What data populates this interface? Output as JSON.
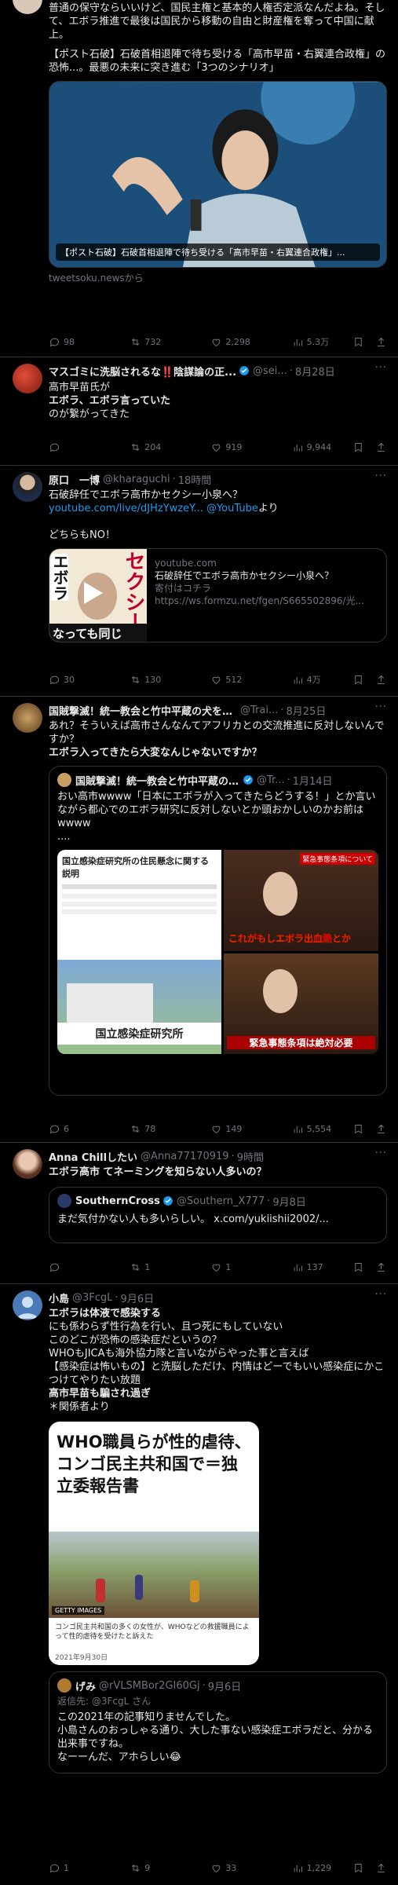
{
  "tweets": [
    {
      "text": "普通の保守ならいいけど、国民主権と基本的人権否定派なんだよね。そして、エボラ推進で最後は国民から移動の自由と財産権を奪って中国に献上。",
      "text2": "【ポスト石破】石破首相退陣で待ち受ける「高市早苗・右翼連合政権」の恐怖...。最悪の未来に突き進む「3つのシナリオ」",
      "card_caption": "【ポスト石破】石破首相退陣で待ち受ける「高市早苗・右翼連合政権」...",
      "card_source": "tweetsoku.newsから",
      "counts": {
        "reply": "98",
        "retweet": "732",
        "like": "2,298",
        "views": "5.3万"
      }
    },
    {
      "name": "マスゴミに洗脳されるな‼️陰謀論の正...",
      "handle": "@sei...",
      "time": "8月28日",
      "lines": [
        "高市早苗氏が",
        "エボラ、エボラ言っていた",
        "のが繋がってきた"
      ],
      "counts": {
        "reply": "",
        "retweet": "204",
        "like": "919",
        "views": "9,944"
      }
    },
    {
      "name": "原口　一博",
      "handle": "@kharaguchi",
      "time": "18時間",
      "line1": "石破辞任でエボラ高市かセクシー小泉へ？",
      "link1": "youtube.com/live/dJHzYwzeY...",
      "link2": "@YouTube",
      "link_tail": "より",
      "line3": "どちらもNO！",
      "card_domain": "youtube.com",
      "card_title": "石破辞任でエボラ高市かセクシー小泉へ？",
      "card_desc": "寄付はコチラ",
      "card_url": "https://ws.formzu.net/fgen/S665502896/光...",
      "thumb_text": "セクシー",
      "thumb_text2": "エボラ",
      "thumb_bottom": "なっても同じ",
      "counts": {
        "reply": "30",
        "retweet": "130",
        "like": "512",
        "views": "4万"
      }
    },
    {
      "name": "国賊撃滅！統一教会と竹中平蔵の犬を日...",
      "handle": "@Trai...",
      "time": "8月25日",
      "line1": "あれ？そういえば高市さんなんてアフリカとの交流推進に反対しないんですか？",
      "line2": "エボラ入ってきたら大変なんじゃないですか？",
      "quote_name": "国賊撃滅！統一教会と竹中平蔵の犬...",
      "quote_handle": "@Tr...",
      "quote_time": "1月14日",
      "quote_text": "おい高市wwww「日本にエボラが入ってきたらどうする！」とか言いながら都心でのエボラ研究に反対しないとか頭おかしいのかお前はwwww",
      "quote_tail": "....",
      "img_left_title": "国立感染症研究所の住民懸念に関する説明",
      "img_left_sign": "国立感染症研究所",
      "img_right_top": "緊急事態条項について",
      "img_right_mid": "これがもしエボラ出血熱とか",
      "img_right_bottom": "緊急事態条項は絶対必要",
      "counts": {
        "reply": "6",
        "retweet": "78",
        "like": "149",
        "views": "5,554"
      }
    },
    {
      "name": "Anna Chillしたい",
      "handle": "@Anna77170919",
      "time": "9時間",
      "line1": "エボラ高市 てネーミングを知らない人多いの？",
      "quote_name": "SouthernCross",
      "quote_handle": "@Southern_X777",
      "quote_time": "9月8日",
      "quote_text": "まだ気付かない人も多いらしい。 x.com/yukiishii2002/...",
      "counts": {
        "reply": "",
        "retweet": "1",
        "like": "1",
        "views": "137"
      }
    },
    {
      "name": "小島",
      "handle": "@3FcgL",
      "time": "9月6日",
      "lines": [
        "エボラは体液で感染する",
        "にも係わらず性行為を行い、且つ死にもしていない",
        "このどこが恐怖の感染症だというの？",
        "WHOもJICAも海外協力隊と言いながらやった事と言えば",
        "【感染症は怖いもの】と洗脳しただけ、内情はどーでもいい感染症にかこつけてやりたい放題",
        "高市早苗も騙され過ぎ",
        "＊関係者より"
      ],
      "img_headline": "WHO職員らが性的虐待、コンゴ民主共和国で＝独立委報告書",
      "img_badge": "GETTY IMAGES",
      "img_caption": "コンゴ民主共和国の多くの女性が、WHOなどの救援職員によって性的虐待を受けたと訴えた",
      "img_date": "2021年9月30日",
      "reply_name": "げみ",
      "reply_handle": "@rVLSMBor2GI60Gj",
      "reply_time": "9月6日",
      "reply_to": "返信先: @3FcgL さん",
      "reply_lines": [
        "この2021年の記事知りませんでした。",
        "小島さんのおっしゃる通り、大した事ない感染症エボラだと、分かる出来事ですね。",
        "なーーんだ、アホらしい😂"
      ],
      "counts": {
        "reply": "1",
        "retweet": "9",
        "like": "33",
        "views": "1,229"
      }
    }
  ],
  "colors": {
    "accent": "#1d9bf0",
    "bg": "#000000",
    "muted": "#71767b",
    "border": "#2f3336"
  }
}
